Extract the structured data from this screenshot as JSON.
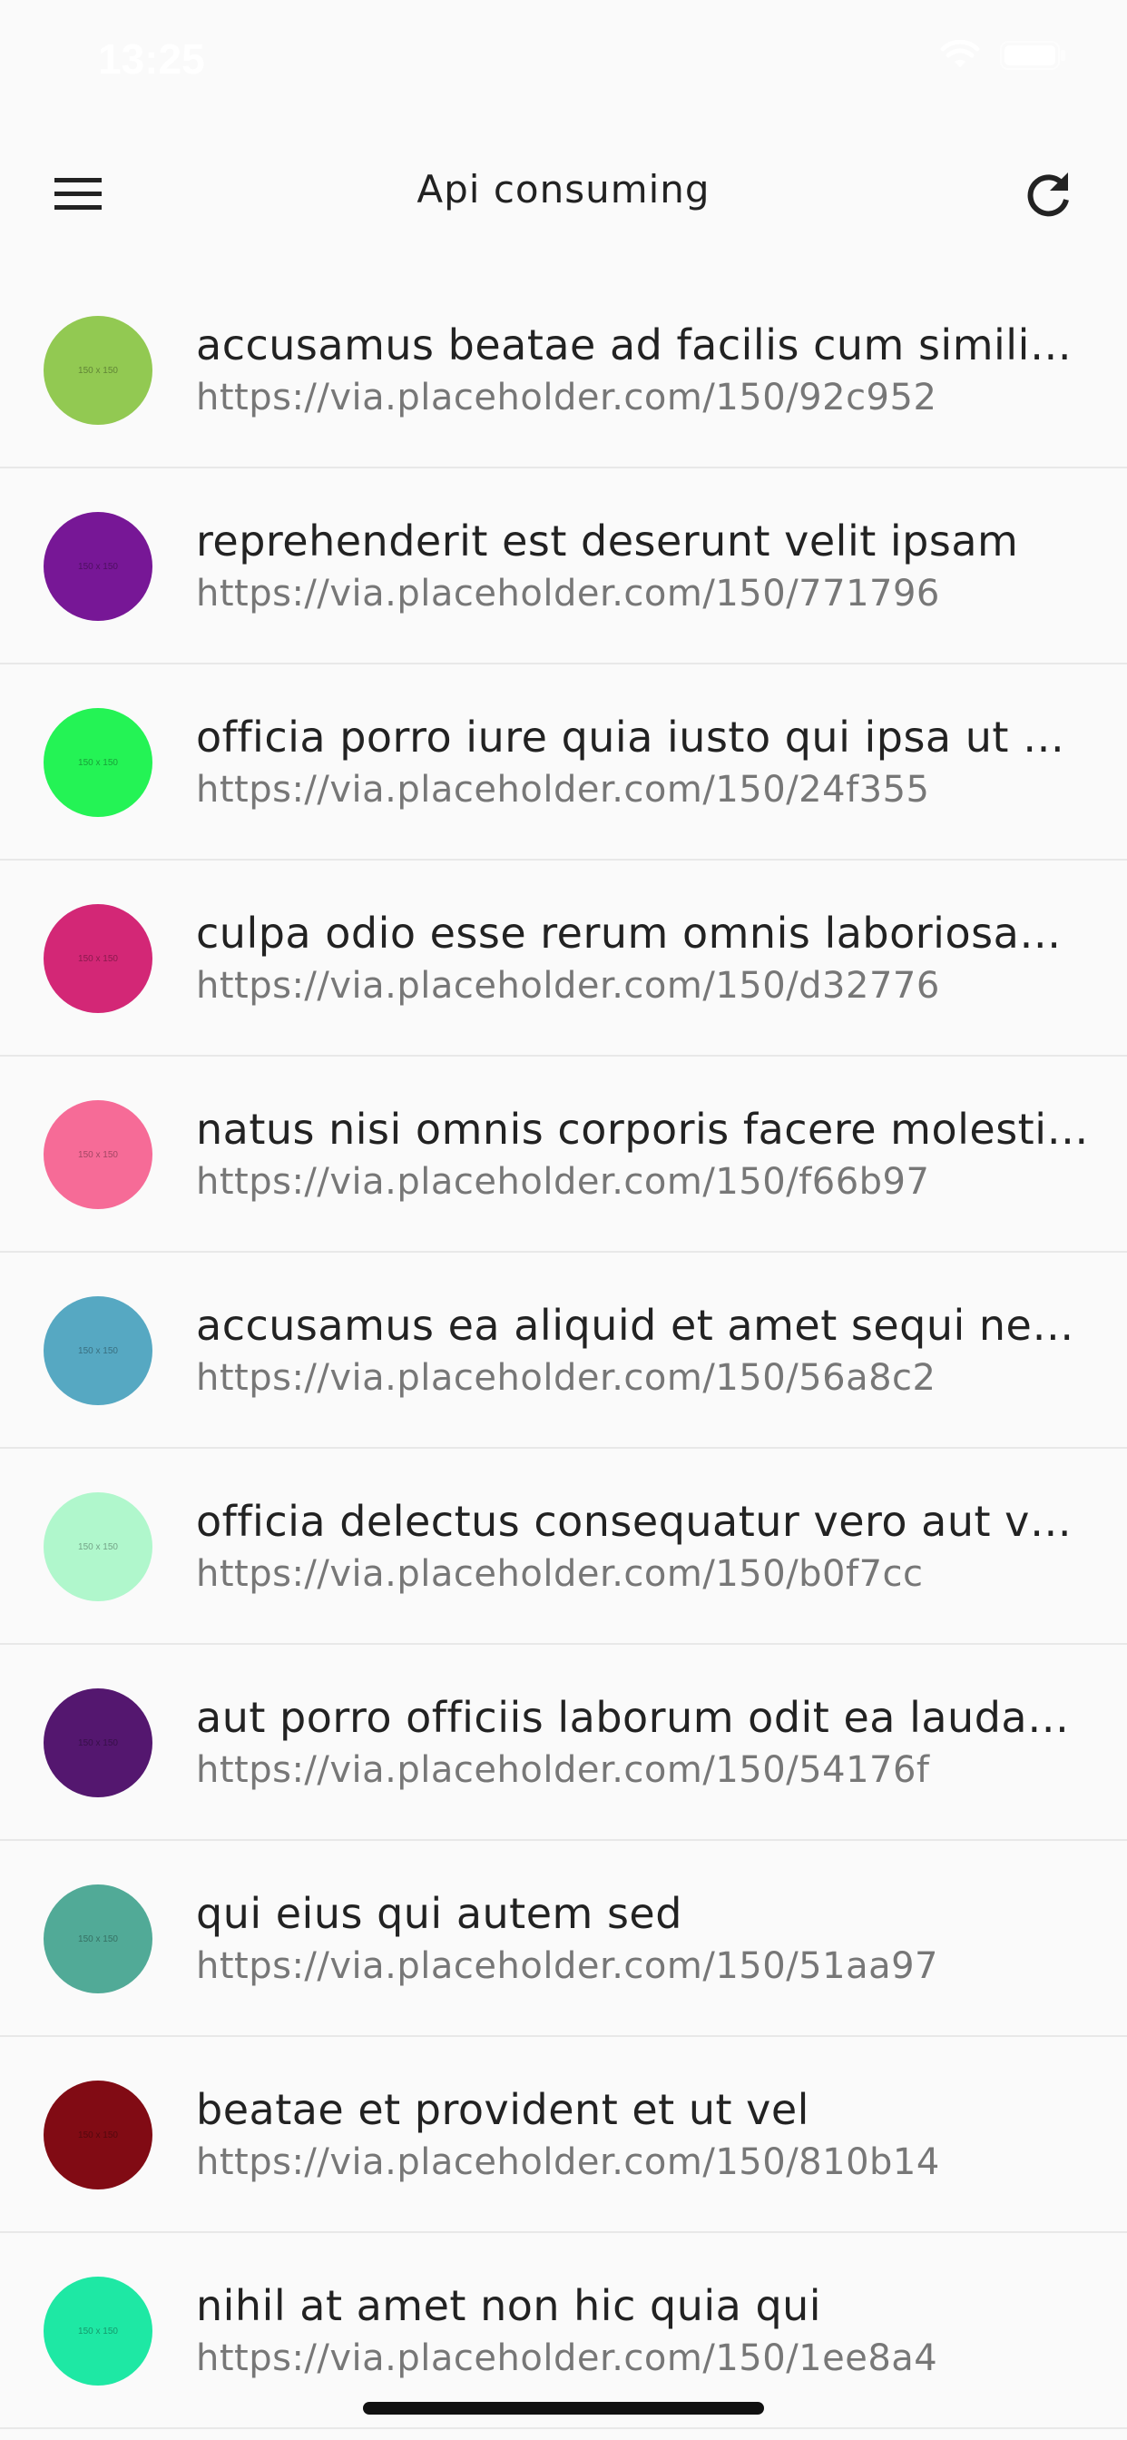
{
  "status_bar": {
    "time": "13:25",
    "icons": [
      "wifi-icon",
      "battery-icon"
    ]
  },
  "app_bar": {
    "title": "Api consuming",
    "menu_icon": "hamburger-menu-icon",
    "refresh_icon": "refresh-icon"
  },
  "items": [
    {
      "title": "accusamus beatae ad facilis cum similique qui sunt",
      "url": "https://via.placeholder.com/150/92c952",
      "color": "#92c952",
      "thumb_label": "150 x 150"
    },
    {
      "title": "reprehenderit est deserunt velit ipsam",
      "url": "https://via.placeholder.com/150/771796",
      "color": "#771796",
      "thumb_label": "150 x 150"
    },
    {
      "title": "officia porro iure quia iusto qui ipsa ut modi",
      "url": "https://via.placeholder.com/150/24f355",
      "color": "#24f355",
      "thumb_label": "150 x 150"
    },
    {
      "title": "culpa odio esse rerum omnis laboriosam voluptate repudiandae",
      "url": "https://via.placeholder.com/150/d32776",
      "color": "#d32776",
      "thumb_label": "150 x 150"
    },
    {
      "title": "natus nisi omnis corporis facere molestiae rerum in",
      "url": "https://via.placeholder.com/150/f66b97",
      "color": "#f66b97",
      "thumb_label": "150 x 150"
    },
    {
      "title": "accusamus ea aliquid et amet sequi nemo",
      "url": "https://via.placeholder.com/150/56a8c2",
      "color": "#56a8c2",
      "thumb_label": "150 x 150"
    },
    {
      "title": "officia delectus consequatur vero aut veniam explicabo molestias",
      "url": "https://via.placeholder.com/150/b0f7cc",
      "color": "#b0f7cc",
      "thumb_label": "150 x 150"
    },
    {
      "title": "aut porro officiis laborum odit ea laudantium corporis",
      "url": "https://via.placeholder.com/150/54176f",
      "color": "#54176f",
      "thumb_label": "150 x 150"
    },
    {
      "title": "qui eius qui autem sed",
      "url": "https://via.placeholder.com/150/51aa97",
      "color": "#51aa97",
      "thumb_label": "150 x 150"
    },
    {
      "title": "beatae et provident et ut vel",
      "url": "https://via.placeholder.com/150/810b14",
      "color": "#810b14",
      "thumb_label": "150 x 150"
    },
    {
      "title": "nihil at amet non hic quia qui",
      "url": "https://via.placeholder.com/150/1ee8a4",
      "color": "#1ee8a4",
      "thumb_label": "150 x 150"
    }
  ]
}
